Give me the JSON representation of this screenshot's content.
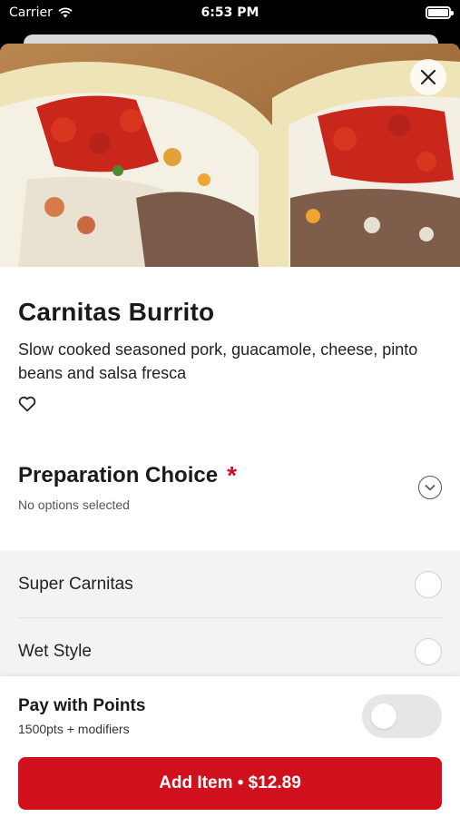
{
  "status_bar": {
    "carrier": "Carrier",
    "time": "6:53 PM"
  },
  "hero": {
    "image_alt_icon": "burrito-photo"
  },
  "item": {
    "title": "Carnitas Burrito",
    "description": "Slow cooked seasoned pork, guacamole, cheese, pinto beans and salsa fresca",
    "favorite_icon": "heart-outline-icon"
  },
  "preparation": {
    "title": "Preparation Choice",
    "required_marker": "*",
    "subtitle": "No options selected",
    "options": [
      {
        "label": "Super Carnitas",
        "selected": false
      },
      {
        "label": "Wet Style",
        "selected": false
      }
    ]
  },
  "points": {
    "title": "Pay with Points",
    "subtitle": "1500pts + modifiers",
    "enabled": false
  },
  "add_button": {
    "label": "Add Item • $12.89"
  },
  "colors": {
    "accent": "#d0101c",
    "required": "#c8102e"
  }
}
